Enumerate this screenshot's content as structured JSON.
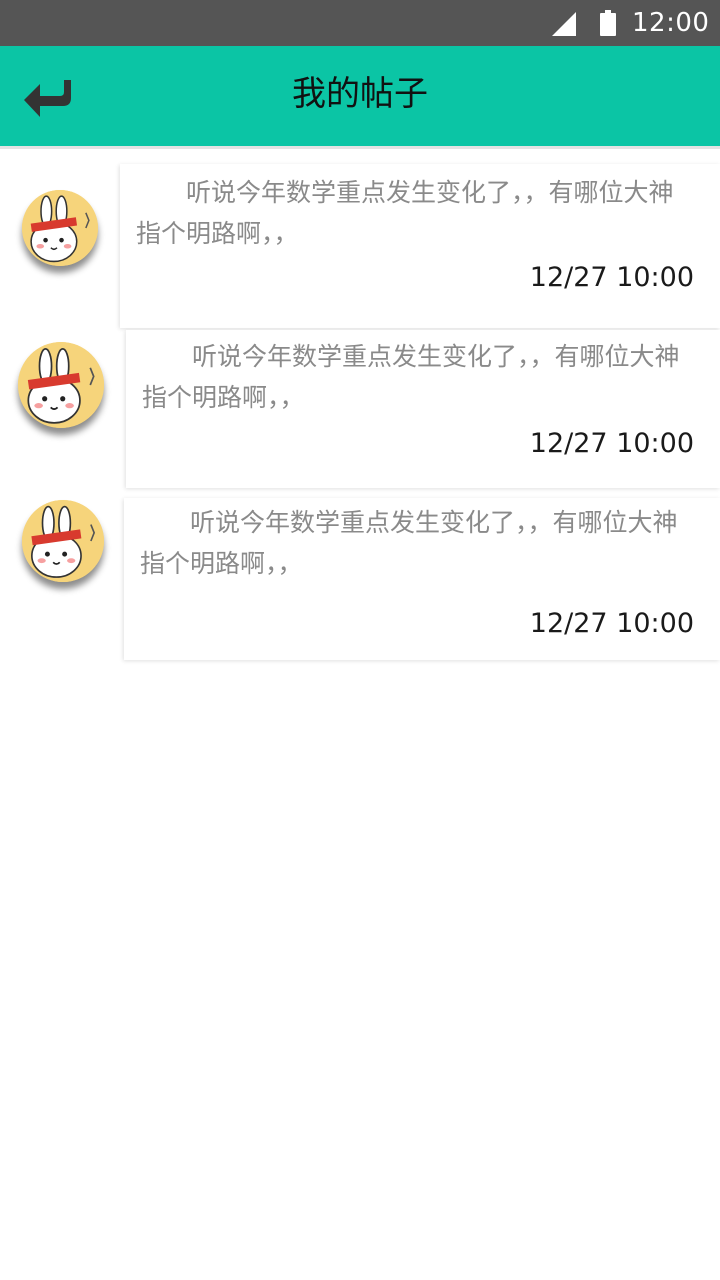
{
  "status_bar": {
    "time": "12:00",
    "signal_icon": "signal-icon",
    "battery_icon": "battery-icon"
  },
  "header": {
    "title": "我的帖子",
    "back_icon": "back-arrow-icon"
  },
  "posts": [
    {
      "text": "听说今年数学重点发生变化了，，有哪位大神指个明路啊，，",
      "time": "12/27 10:00"
    },
    {
      "text": "听说今年数学重点发生变化了，，有哪位大神指个明路啊，，",
      "time": "12/27 10:00"
    },
    {
      "text": "听说今年数学重点发生变化了，，有哪位大神指个明路啊，，",
      "time": "12/27 10:00"
    }
  ],
  "colors": {
    "status_bar": "#555555",
    "app_bar": "#0bc5a5",
    "post_text": "#8a8a8a"
  }
}
